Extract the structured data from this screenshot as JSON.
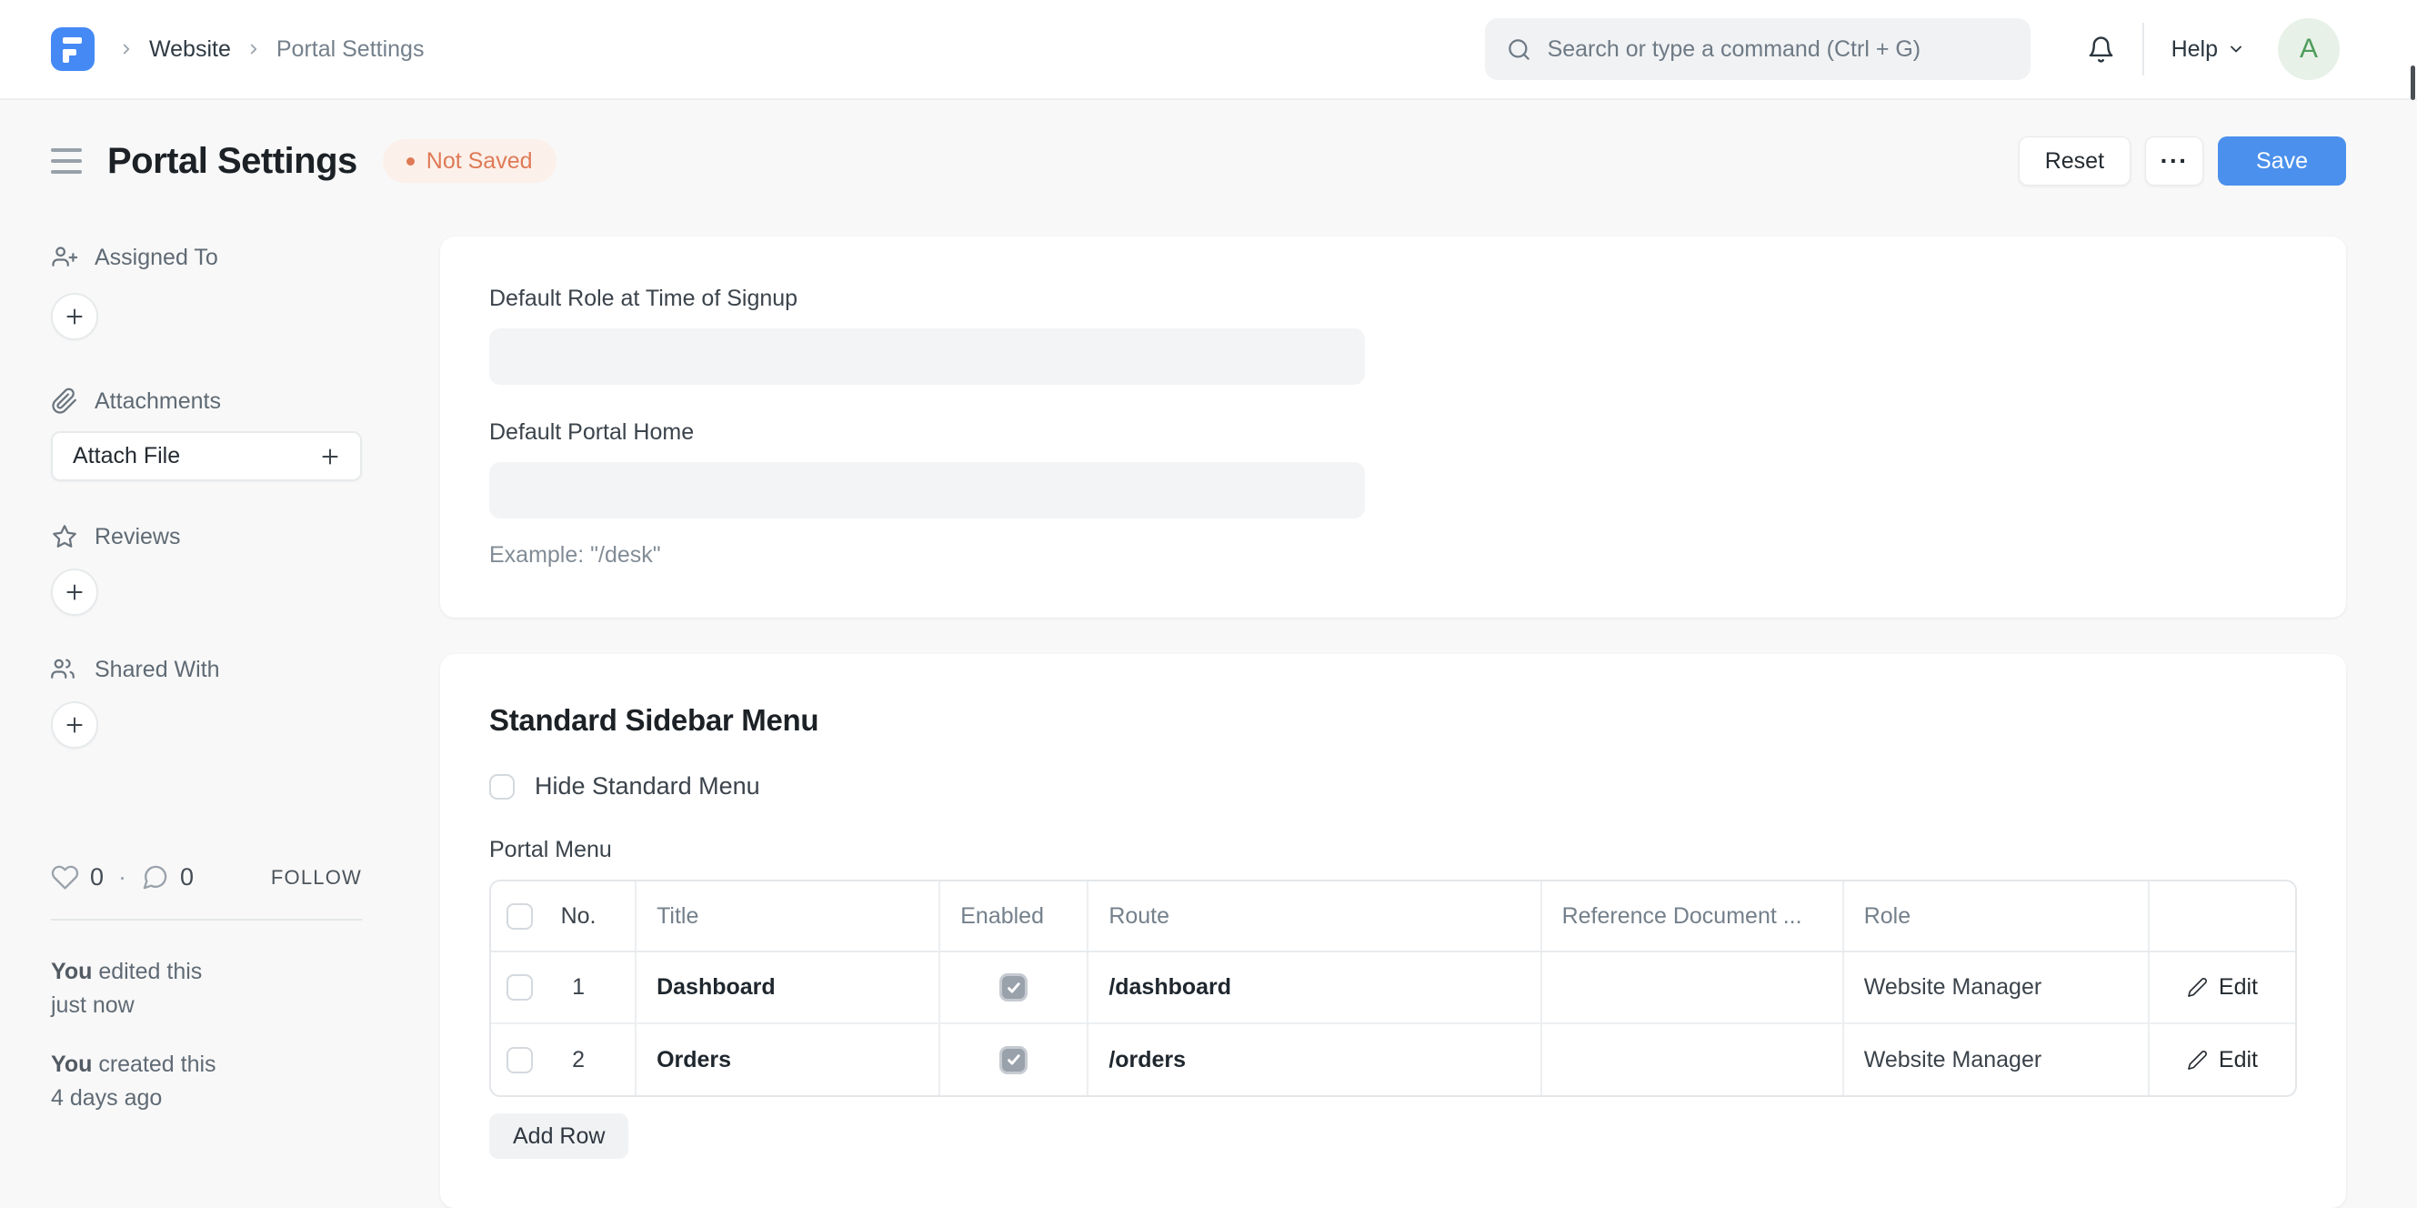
{
  "navbar": {
    "breadcrumb": {
      "level1": "Website",
      "level2": "Portal Settings"
    },
    "search_placeholder": "Search or type a command (Ctrl + G)",
    "help_label": "Help",
    "avatar_initial": "A"
  },
  "page_head": {
    "title": "Portal Settings",
    "status_badge": "Not Saved",
    "reset_label": "Reset",
    "more_label": "···",
    "save_label": "Save"
  },
  "sidebar": {
    "assigned_to_label": "Assigned To",
    "attachments_label": "Attachments",
    "attach_file_label": "Attach File",
    "reviews_label": "Reviews",
    "shared_with_label": "Shared With",
    "likes_count": "0",
    "separator": "·",
    "comments_count": "0",
    "follow_label": "FOLLOW",
    "timeline": [
      {
        "actor": "You",
        "action": " edited this",
        "time": "just now"
      },
      {
        "actor": "You",
        "action": " created this",
        "time": "4 days ago"
      }
    ]
  },
  "form": {
    "default_role_label": "Default Role at Time of Signup",
    "default_role_value": "",
    "default_portal_home_label": "Default Portal Home",
    "default_portal_home_value": "",
    "portal_home_example": "Example: \"/desk\""
  },
  "menu_section": {
    "heading": "Standard Sidebar Menu",
    "hide_standard_menu_label": "Hide Standard Menu",
    "hide_standard_menu_checked": false,
    "portal_menu_label": "Portal Menu",
    "table": {
      "headers": {
        "no": "No.",
        "title": "Title",
        "enabled": "Enabled",
        "route": "Route",
        "reference_document": "Reference Document ...",
        "role": "Role",
        "actions": ""
      },
      "rows": [
        {
          "no": "1",
          "title": "Dashboard",
          "enabled": true,
          "route": "/dashboard",
          "reference_document": "",
          "role": "Website Manager",
          "edit_label": "Edit"
        },
        {
          "no": "2",
          "title": "Orders",
          "enabled": true,
          "route": "/orders",
          "reference_document": "",
          "role": "Website Manager",
          "edit_label": "Edit"
        }
      ]
    },
    "add_row_label": "Add Row"
  },
  "colors": {
    "primary": "#4b90ec",
    "logo_blue": "#4589f5",
    "badge_text": "#df7a56",
    "badge_bg": "#fcf0ea",
    "avatar_bg": "#e7f1e8",
    "avatar_text": "#4e9d5c",
    "page_bg": "#f8f8f8"
  }
}
